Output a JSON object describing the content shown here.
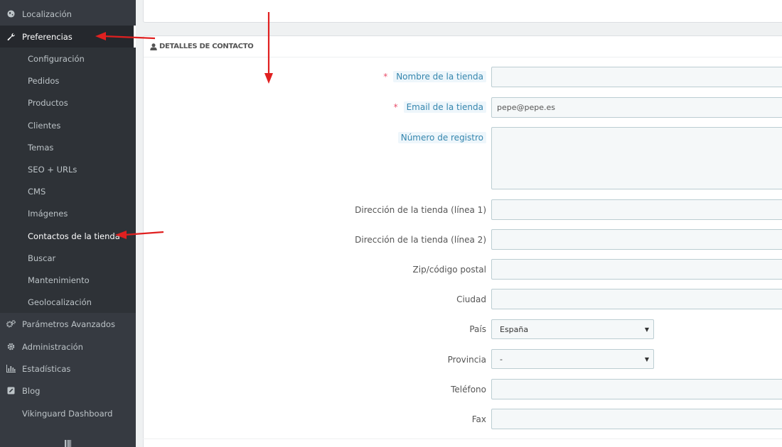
{
  "sidebar": {
    "localizacion": "Localización",
    "preferencias": "Preferencias",
    "sub": [
      "Configuración",
      "Pedidos",
      "Productos",
      "Clientes",
      "Temas",
      "SEO + URLs",
      "CMS",
      "Imágenes",
      "Contactos de la tienda",
      "Buscar",
      "Mantenimiento",
      "Geolocalización"
    ],
    "parametros": "Parámetros Avanzados",
    "administracion": "Administración",
    "estadisticas": "Estadísticas",
    "blog": "Blog",
    "vikinguard": "Vikinguard Dashboard"
  },
  "panel": {
    "heading": "DETALLES DE CONTACTO"
  },
  "form": {
    "required_mark": "*",
    "shop_name_label": "Nombre de la tienda",
    "shop_name_value": "",
    "shop_email_label": "Email de la tienda",
    "shop_email_value": "pepe@pepe.es",
    "registration_label": "Número de registro",
    "registration_value": "",
    "address1_label": "Dirección de la tienda (línea 1)",
    "address2_label": "Dirección de la tienda (línea 2)",
    "zip_label": "Zip/código postal",
    "city_label": "Ciudad",
    "country_label": "País",
    "country_value": "España",
    "state_label": "Provincia",
    "state_value": "-",
    "phone_label": "Teléfono",
    "fax_label": "Fax"
  },
  "colors": {
    "sidebar_bg": "#363a41",
    "annotation_red": "#e02020",
    "required": "#e84e6a",
    "hint_text": "#3586ae"
  }
}
